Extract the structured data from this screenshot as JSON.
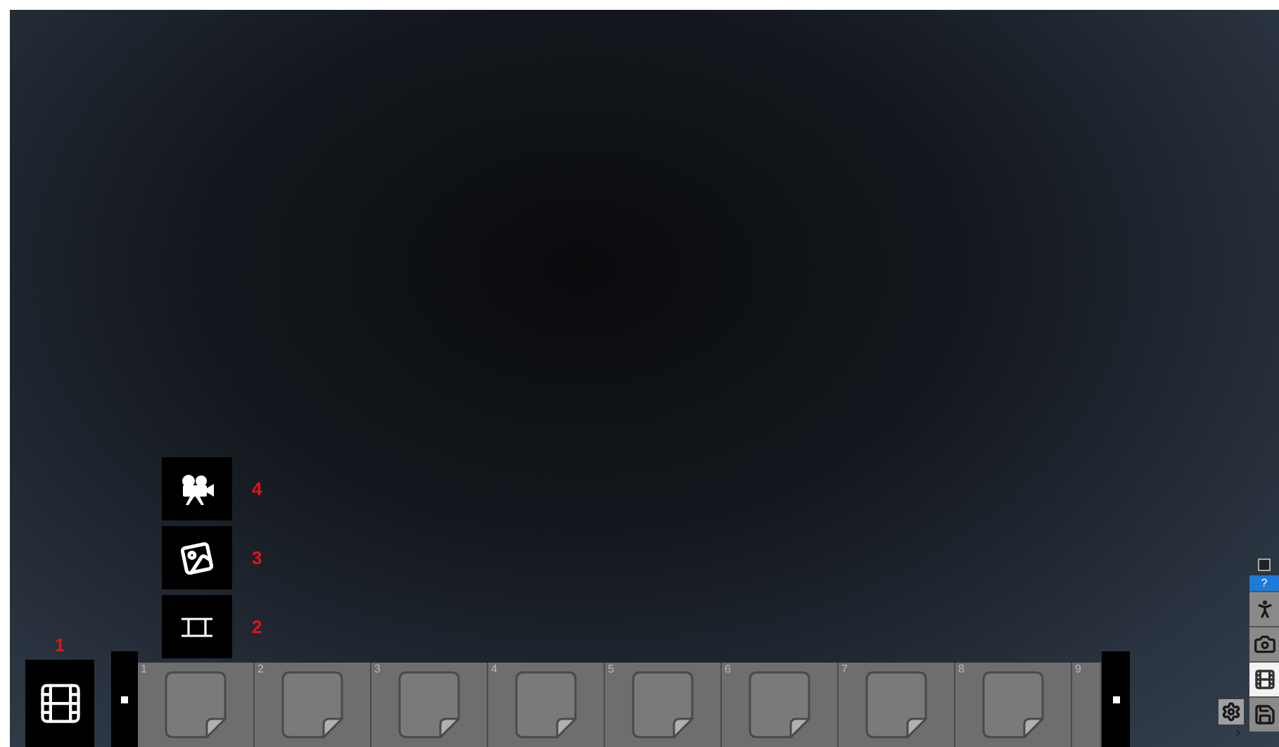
{
  "menu": [
    {
      "kind": "movie-camera",
      "label": "4"
    },
    {
      "kind": "photo",
      "label": "3"
    },
    {
      "kind": "strip",
      "label": "2"
    }
  ],
  "film_button": {
    "label": "1"
  },
  "frames": [
    {
      "number": "1",
      "kind": "page"
    },
    {
      "number": "2",
      "kind": "page"
    },
    {
      "number": "3",
      "kind": "page"
    },
    {
      "number": "4",
      "kind": "page"
    },
    {
      "number": "5",
      "kind": "page"
    },
    {
      "number": "6",
      "kind": "page"
    },
    {
      "number": "7",
      "kind": "page"
    },
    {
      "number": "8",
      "kind": "page"
    },
    {
      "number": "9",
      "kind": "cut"
    }
  ],
  "toolbar": {
    "help": "?",
    "tools": [
      {
        "kind": "hiker",
        "selected": false
      },
      {
        "kind": "camera",
        "selected": false
      },
      {
        "kind": "film",
        "selected": true
      },
      {
        "kind": "save",
        "selected": false
      }
    ]
  }
}
